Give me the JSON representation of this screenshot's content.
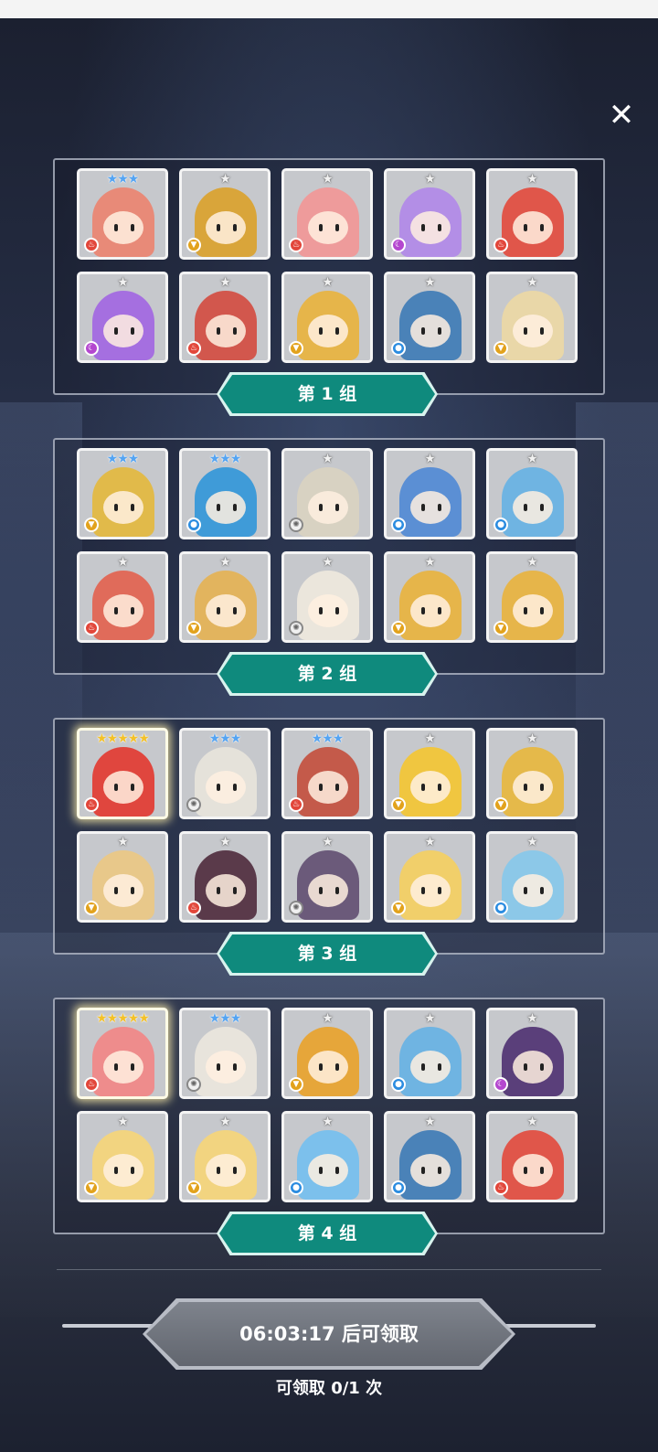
{
  "close_icon": "close-icon",
  "colors": {
    "group_label_bg": "#0f8a7d",
    "timer_button_bg": "#6f737c",
    "card_bg": "#c6c8cc"
  },
  "groups": [
    {
      "label": "第 1 组",
      "cards": [
        {
          "stars": "★★★",
          "tier": "blue",
          "element": "fire",
          "color": "#e88a78"
        },
        {
          "stars": "★",
          "tier": "grey",
          "element": "earth",
          "color": "#d9a53a"
        },
        {
          "stars": "★",
          "tier": "grey",
          "element": "fire",
          "color": "#ee9b9b"
        },
        {
          "stars": "★",
          "tier": "grey",
          "element": "dark",
          "color": "#b38ee6"
        },
        {
          "stars": "★",
          "tier": "grey",
          "element": "fire",
          "color": "#e0564a"
        },
        {
          "stars": "★",
          "tier": "grey",
          "element": "dark",
          "color": "#a56fe0"
        },
        {
          "stars": "★",
          "tier": "grey",
          "element": "fire",
          "color": "#d2574d"
        },
        {
          "stars": "★",
          "tier": "grey",
          "element": "earth",
          "color": "#e6b54a"
        },
        {
          "stars": "★",
          "tier": "grey",
          "element": "water",
          "color": "#4a82b8"
        },
        {
          "stars": "★",
          "tier": "grey",
          "element": "earth",
          "color": "#e9d7a8"
        }
      ]
    },
    {
      "label": "第 2 组",
      "cards": [
        {
          "stars": "★★★",
          "tier": "blue",
          "element": "earth",
          "color": "#e1ba4a"
        },
        {
          "stars": "★★★",
          "tier": "blue",
          "element": "water",
          "color": "#3f9bd8"
        },
        {
          "stars": "★",
          "tier": "grey",
          "element": "light",
          "color": "#d8d2c2"
        },
        {
          "stars": "★",
          "tier": "grey",
          "element": "water",
          "color": "#5b8fd4"
        },
        {
          "stars": "★",
          "tier": "grey",
          "element": "water",
          "color": "#6fb4e2"
        },
        {
          "stars": "★",
          "tier": "grey",
          "element": "fire",
          "color": "#e06b5a"
        },
        {
          "stars": "★",
          "tier": "grey",
          "element": "earth",
          "color": "#e2b45e"
        },
        {
          "stars": "★",
          "tier": "grey",
          "element": "light",
          "color": "#ebe6dc"
        },
        {
          "stars": "★",
          "tier": "grey",
          "element": "earth",
          "color": "#e6b54a"
        },
        {
          "stars": "★",
          "tier": "grey",
          "element": "earth",
          "color": "#e6b54a"
        }
      ]
    },
    {
      "label": "第 3 组",
      "cards": [
        {
          "stars": "★★★★★",
          "tier": "gold",
          "element": "fire",
          "color": "#e0463e",
          "legend": true
        },
        {
          "stars": "★★★",
          "tier": "blue",
          "element": "light",
          "color": "#e5e2da"
        },
        {
          "stars": "★★★",
          "tier": "blue",
          "element": "fire",
          "color": "#c45a4a"
        },
        {
          "stars": "★",
          "tier": "grey",
          "element": "earth",
          "color": "#f0c640"
        },
        {
          "stars": "★",
          "tier": "grey",
          "element": "earth",
          "color": "#e5b94a"
        },
        {
          "stars": "★",
          "tier": "grey",
          "element": "earth",
          "color": "#e8c88a"
        },
        {
          "stars": "★",
          "tier": "grey",
          "element": "fire",
          "color": "#5a3a4a"
        },
        {
          "stars": "★",
          "tier": "grey",
          "element": "light",
          "color": "#6b5a7a"
        },
        {
          "stars": "★",
          "tier": "grey",
          "element": "earth",
          "color": "#f1cf6a"
        },
        {
          "stars": "★",
          "tier": "grey",
          "element": "water",
          "color": "#8cc8e8"
        }
      ]
    },
    {
      "label": "第 4 组",
      "cards": [
        {
          "stars": "★★★★★",
          "tier": "gold",
          "element": "fire",
          "color": "#ee8c8c",
          "legend": true
        },
        {
          "stars": "★★★",
          "tier": "blue",
          "element": "light",
          "color": "#e8e4dc"
        },
        {
          "stars": "★",
          "tier": "grey",
          "element": "earth",
          "color": "#e6a63a"
        },
        {
          "stars": "★",
          "tier": "grey",
          "element": "water",
          "color": "#6fb4e2"
        },
        {
          "stars": "★",
          "tier": "grey",
          "element": "dark",
          "color": "#5a3f7a"
        },
        {
          "stars": "★",
          "tier": "grey",
          "element": "earth",
          "color": "#f2d480"
        },
        {
          "stars": "★",
          "tier": "grey",
          "element": "earth",
          "color": "#f2d480"
        },
        {
          "stars": "★",
          "tier": "grey",
          "element": "water",
          "color": "#7cc0ec"
        },
        {
          "stars": "★",
          "tier": "grey",
          "element": "water",
          "color": "#4a82b8"
        },
        {
          "stars": "★",
          "tier": "grey",
          "element": "fire",
          "color": "#e0564a"
        }
      ]
    }
  ],
  "footer": {
    "timer_label": "06:03:17 后可领取",
    "claim_count": "可领取 0/1 次"
  }
}
